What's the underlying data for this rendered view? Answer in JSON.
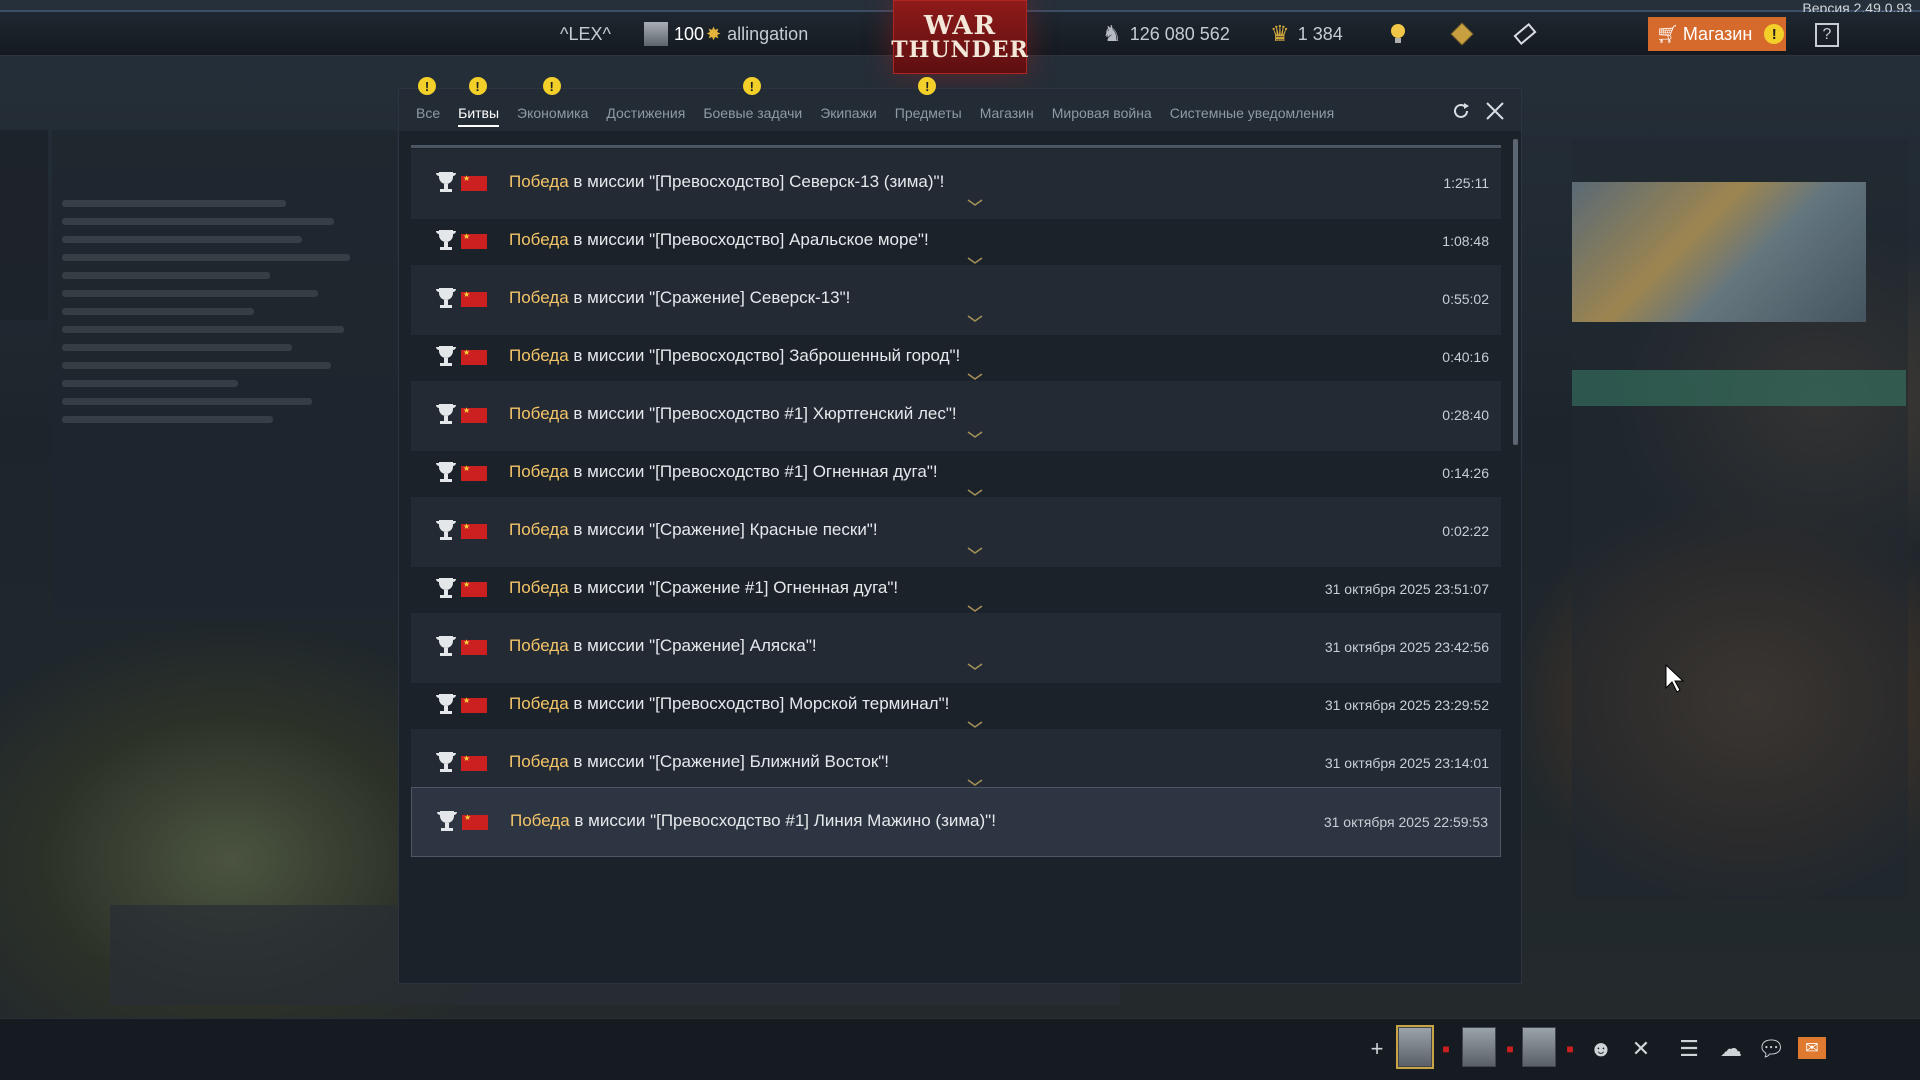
{
  "version": "Версия 2.49.0.93",
  "topbar": {
    "username": "^LEX^",
    "level": "100",
    "nickname": "allingation",
    "logo_line1": "WAR",
    "logo_line2": "THUNDER",
    "silver_lions": "126 080 562",
    "golden_eagles": "1 384",
    "shop_label": "Магазин",
    "help_label": "?"
  },
  "tabs": [
    {
      "label": "Все",
      "warn": true
    },
    {
      "label": "Битвы",
      "warn": true,
      "active": true
    },
    {
      "label": "Экономика",
      "warn": true
    },
    {
      "label": "Достижения",
      "warn": false
    },
    {
      "label": "Боевые задачи",
      "warn": true
    },
    {
      "label": "Экипажи",
      "warn": false
    },
    {
      "label": "Предметы",
      "warn": true
    },
    {
      "label": "Магазин",
      "warn": false
    },
    {
      "label": "Мировая война",
      "warn": false
    },
    {
      "label": "Системные уведомления",
      "warn": false
    }
  ],
  "warn_mark": "!",
  "rows": [
    {
      "win": "Победа",
      "text": " в миссии \"[Превосходство] Северск-13 (зима)\"!",
      "time": "1:25:11"
    },
    {
      "win": "Победа",
      "text": " в миссии \"[Превосходство] Аральское море\"!",
      "time": "1:08:48"
    },
    {
      "win": "Победа",
      "text": " в миссии \"[Сражение] Северск-13\"!",
      "time": "0:55:02"
    },
    {
      "win": "Победа",
      "text": " в миссии \"[Превосходство] Заброшенный город\"!",
      "time": "0:40:16"
    },
    {
      "win": "Победа",
      "text": " в миссии \"[Превосходство #1] Хюртгенский лес\"!",
      "time": "0:28:40"
    },
    {
      "win": "Победа",
      "text": " в миссии \"[Превосходство #1] Огненная дуга\"!",
      "time": "0:14:26"
    },
    {
      "win": "Победа",
      "text": " в миссии \"[Сражение] Красные пески\"!",
      "time": "0:02:22"
    },
    {
      "win": "Победа",
      "text": " в миссии \"[Сражение #1] Огненная дуга\"!",
      "time": "31 октября 2025 23:51:07"
    },
    {
      "win": "Победа",
      "text": " в миссии \"[Сражение] Аляска\"!",
      "time": "31 октября 2025 23:42:56"
    },
    {
      "win": "Победа",
      "text": " в миссии \"[Превосходство] Морской терминал\"!",
      "time": "31 октября 2025 23:29:52"
    },
    {
      "win": "Победа",
      "text": " в миссии \"[Сражение] Ближний Восток\"!",
      "time": "31 октября 2025 23:14:01"
    },
    {
      "win": "Победа",
      "text": " в миссии \"[Превосходство #1] Линия Мажино (зима)\"!",
      "time": "31 октября 2025 22:59:53"
    }
  ],
  "colors": {
    "win": "#f4c568",
    "accent": "#d56a2c",
    "warn": "#f3cf2a",
    "flag": "#cc1f1f"
  },
  "icons": [
    "trophy-icon",
    "ussr-flag-icon",
    "chevron-down-icon",
    "refresh-icon",
    "close-icon",
    "cart-icon",
    "plus-icon",
    "list-icon",
    "squad-icon",
    "chat-icon",
    "mail-icon"
  ]
}
